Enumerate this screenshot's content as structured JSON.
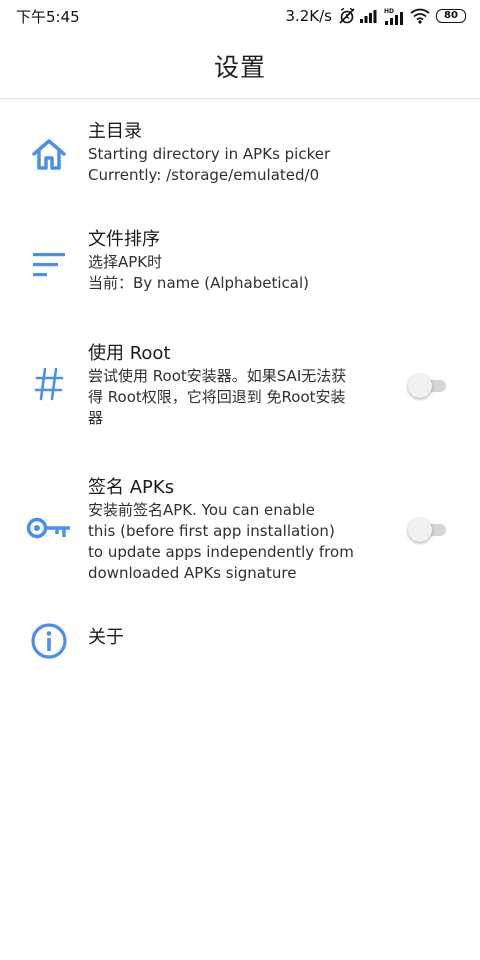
{
  "status_bar": {
    "time": "下午5:45",
    "net_speed": "3.2K/s",
    "battery": "80",
    "icons": [
      "alarm-off-icon",
      "signal-icon",
      "hd-signal-icon",
      "wifi-icon",
      "battery-icon"
    ]
  },
  "toolbar": {
    "title": "设置"
  },
  "preferences": [
    {
      "icon": "home-icon",
      "title": "主目录",
      "summary_lines": [
        "Starting directory in APKs picker",
        "Currently: /storage/emulated/0"
      ]
    },
    {
      "icon": "sort-icon",
      "title": "文件排序",
      "summary_lines": [
        "选择APK时",
        "当前：By name (Alphabetical)"
      ]
    },
    {
      "icon": "hash-icon",
      "title": "使用 Root",
      "summary_lines": [
        "尝试使用 Root安装器。如果SAI无法获",
        "得 Root权限，它将回退到 免Root安装",
        "器"
      ],
      "switch_on": false
    },
    {
      "icon": "key-icon",
      "title": "签名 APKs",
      "summary_lines": [
        "安装前签名APK. You can enable",
        "this (before first app installation)",
        "to update apps independently from",
        "downloaded APKs signature"
      ],
      "switch_on": false
    },
    {
      "icon": "info-icon",
      "title": "关于"
    }
  ],
  "colors": {
    "accent": "#4a8ff0",
    "switch_track_off": "#d5d5d5",
    "switch_thumb_off": "#f1f1f1"
  }
}
